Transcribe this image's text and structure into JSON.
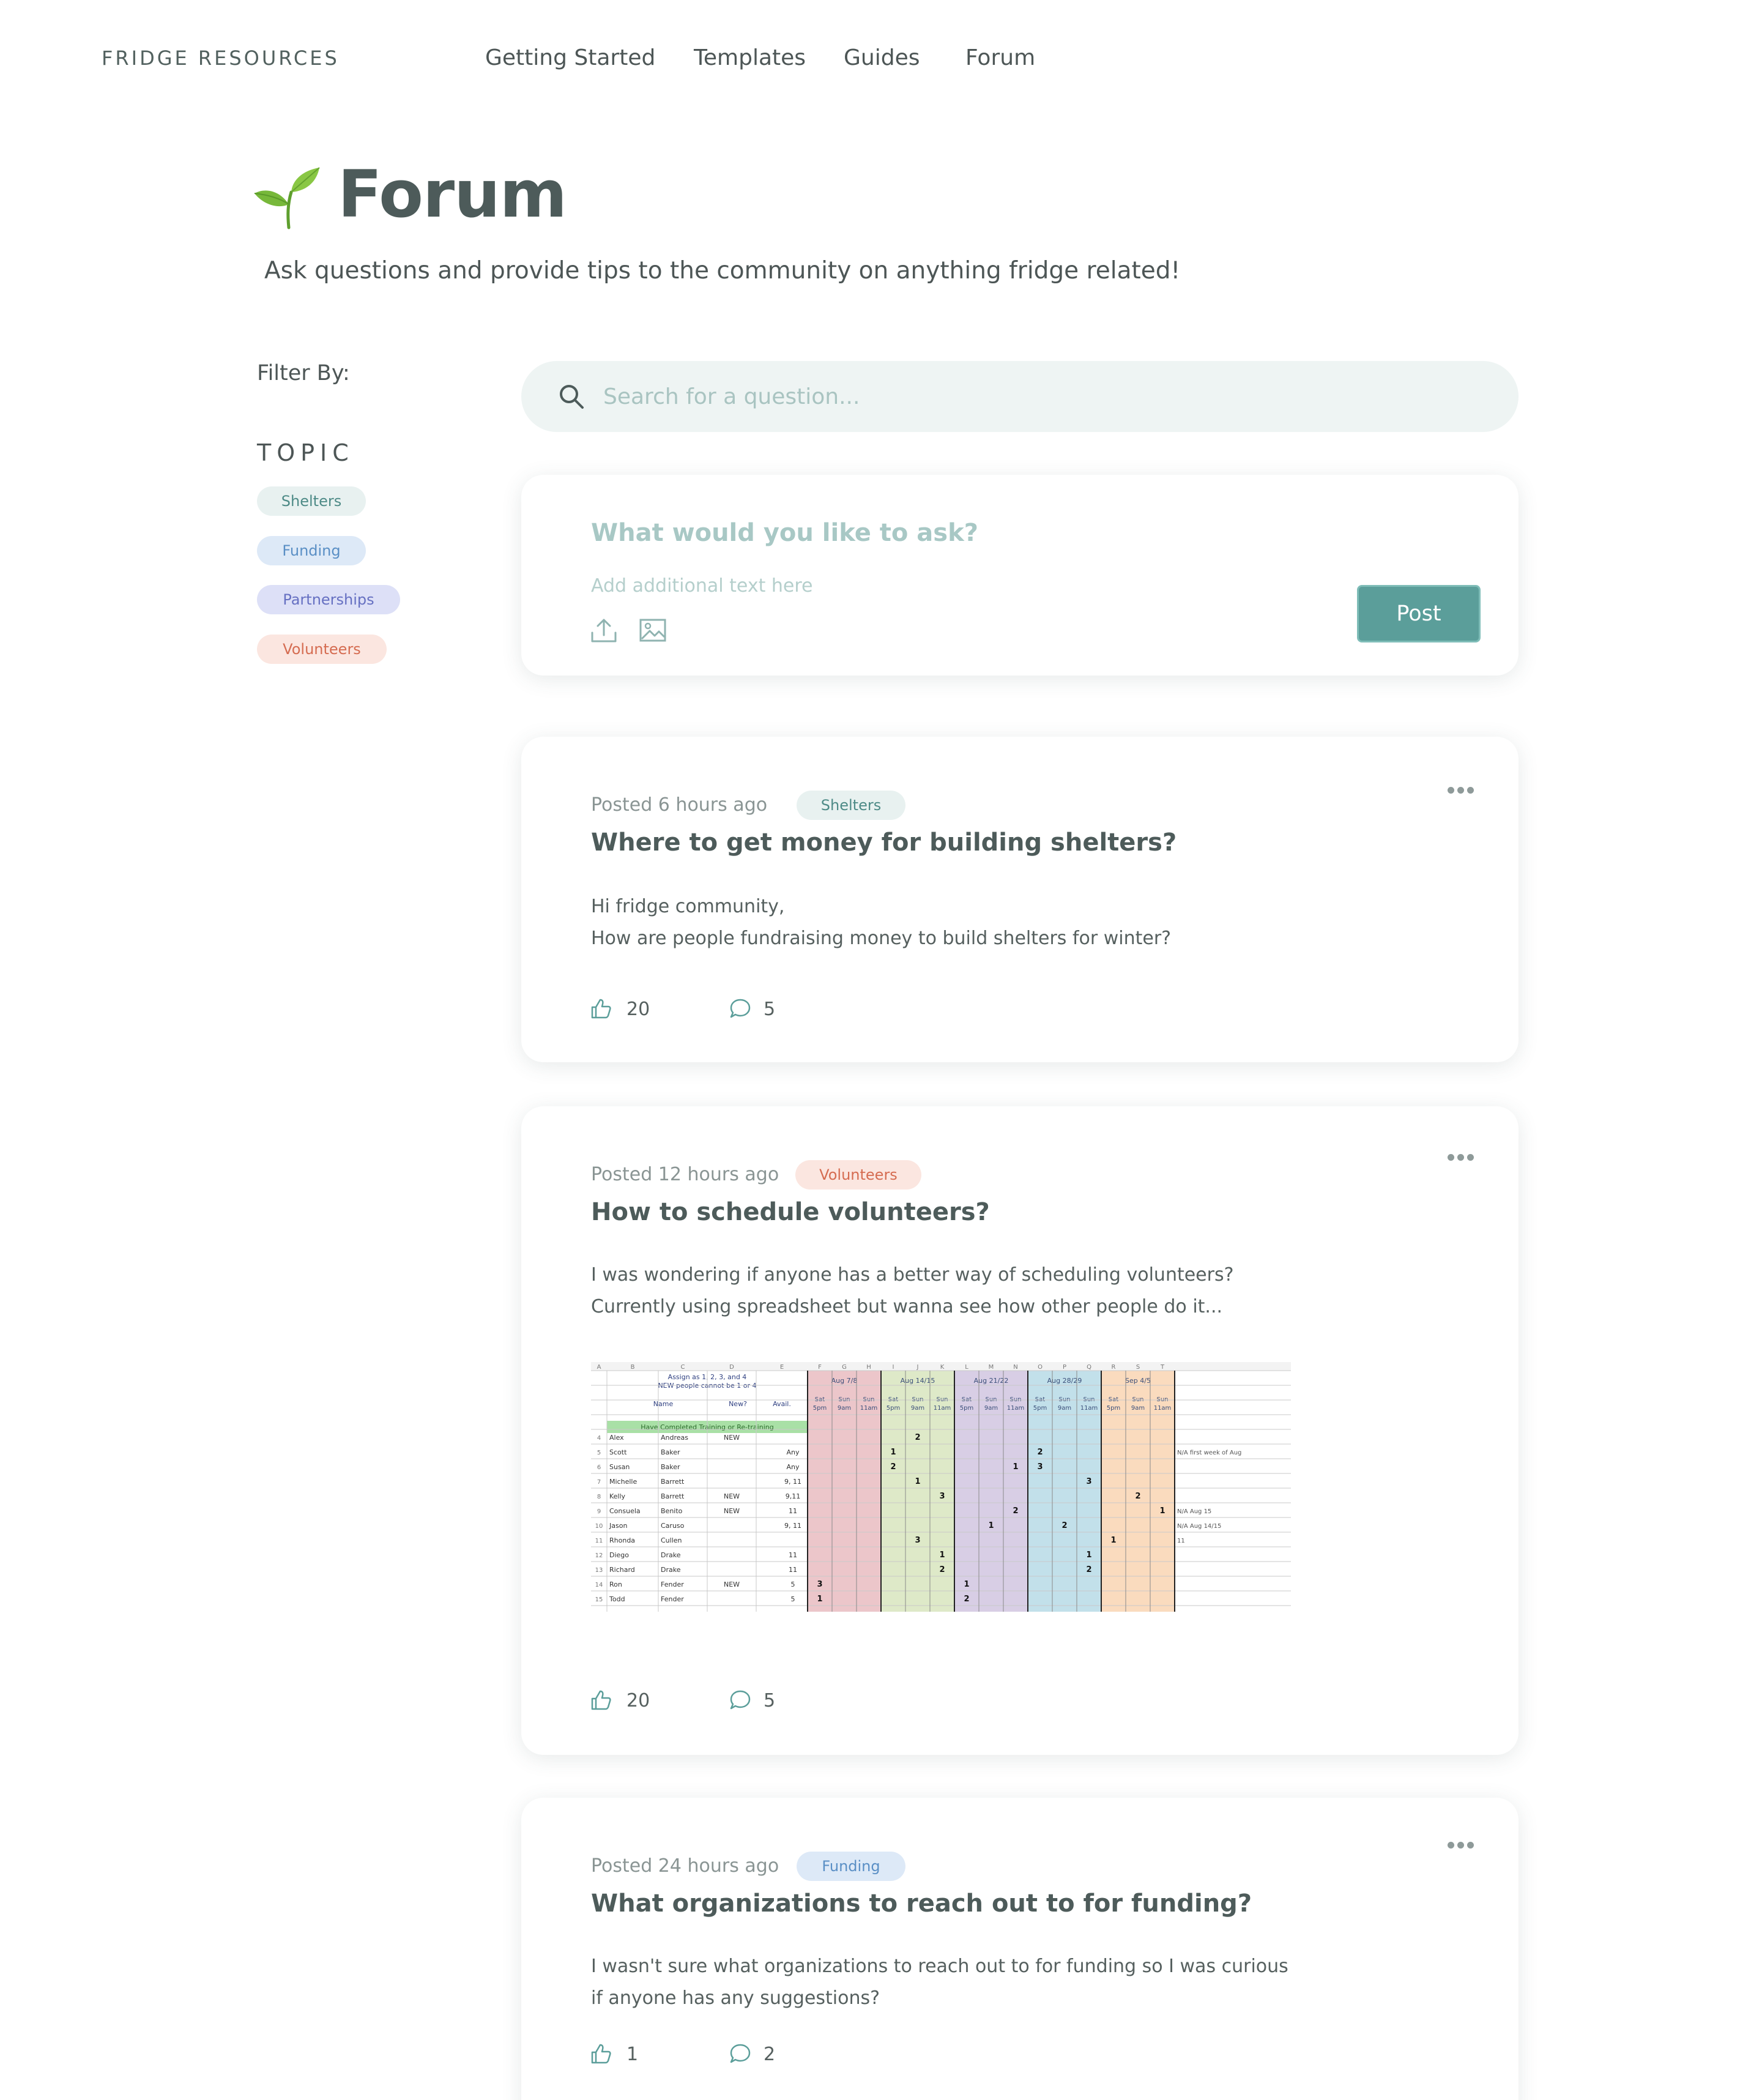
{
  "header": {
    "brand": "FRIDGE RESOURCES",
    "nav": [
      "Getting Started",
      "Templates",
      "Guides",
      "Forum"
    ]
  },
  "hero": {
    "icon": "seedling-icon",
    "title": "Forum",
    "subtitle": "Ask questions and provide tips to the community on anything fridge related!"
  },
  "sidebar": {
    "filter_label": "Filter By:",
    "topic_label": "TOPIC",
    "topics": [
      "Shelters",
      "Funding",
      "Partnerships",
      "Volunteers"
    ]
  },
  "search": {
    "placeholder": "Search for a question..."
  },
  "ask": {
    "placeholder_title": "What would you like to ask?",
    "placeholder_body": "Add additional text here",
    "post_label": "Post",
    "icons": [
      "upload-icon",
      "image-icon"
    ]
  },
  "posts": [
    {
      "posted": "Posted 6 hours ago",
      "tag": "Shelters",
      "title": "Where to get money for building shelters?",
      "body": [
        "Hi fridge community,",
        "How are people fundraising money to build shelters for winter?"
      ],
      "likes": "20",
      "comments": "5"
    },
    {
      "posted": "Posted 12 hours ago",
      "tag": "Volunteers",
      "title": "How to schedule volunteers?",
      "body": [
        "I was wondering if anyone has a better way of scheduling volunteers?",
        "Currently using spreadsheet but wanna see how other people do it..."
      ],
      "likes": "20",
      "comments": "5",
      "spreadsheet": {
        "column_letters": [
          "A",
          "B",
          "C",
          "D",
          "E",
          "F",
          "G",
          "H",
          "I",
          "J",
          "K",
          "L",
          "M",
          "N",
          "O",
          "P",
          "Q",
          "R",
          "S",
          "T"
        ],
        "note_line1": "Assign as 1, 2, 3, and 4",
        "note_line2": "NEW people cannot be 1 or 4",
        "headers": [
          "Name",
          "New?",
          "Avail."
        ],
        "training_note": "Have Completed Training or Re-training",
        "weeks": [
          "Aug 7/8",
          "Aug 14/15",
          "Aug 21/22",
          "Aug 28/29",
          "Sep 4/5"
        ],
        "slot_days": [
          "Sat",
          "Sun",
          "Sun"
        ],
        "slot_times": [
          "5pm",
          "9am",
          "11am"
        ],
        "rows": [
          {
            "first": "Alex",
            "last": "Andreas",
            "new": "NEW",
            "avail": "",
            "marks": [
              [
                4,
                "2"
              ]
            ],
            "note": ""
          },
          {
            "first": "Scott",
            "last": "Baker",
            "new": "",
            "avail": "Any",
            "marks": [
              [
                3,
                "1"
              ],
              [
                9,
                "2"
              ]
            ],
            "note": "N/A first week of Aug"
          },
          {
            "first": "Susan",
            "last": "Baker",
            "new": "",
            "avail": "Any",
            "marks": [
              [
                3,
                "2"
              ],
              [
                8,
                "1"
              ],
              [
                9,
                "3"
              ]
            ],
            "note": ""
          },
          {
            "first": "Michelle",
            "last": "Barrett",
            "new": "",
            "avail": "9, 11",
            "marks": [
              [
                4,
                "1"
              ],
              [
                11,
                "3"
              ]
            ],
            "note": ""
          },
          {
            "first": "Kelly",
            "last": "Barrett",
            "new": "NEW",
            "avail": "9,11",
            "marks": [
              [
                5,
                "3"
              ],
              [
                13,
                "2"
              ]
            ],
            "note": ""
          },
          {
            "first": "Consuela",
            "last": "Benito",
            "new": "NEW",
            "avail": "11",
            "marks": [
              [
                8,
                "2"
              ],
              [
                14,
                "1"
              ]
            ],
            "note": "N/A Aug 15"
          },
          {
            "first": "Jason",
            "last": "Caruso",
            "new": "",
            "avail": "9, 11",
            "marks": [
              [
                7,
                "1"
              ],
              [
                10,
                "2"
              ]
            ],
            "note": "N/A Aug 14/15"
          },
          {
            "first": "Rhonda",
            "last": "Cullen",
            "new": "",
            "avail": "",
            "marks": [
              [
                4,
                "3"
              ],
              [
                12,
                "1"
              ]
            ],
            "note": "11"
          },
          {
            "first": "Diego",
            "last": "Drake",
            "new": "",
            "avail": "11",
            "marks": [
              [
                5,
                "1"
              ],
              [
                11,
                "1"
              ]
            ],
            "note": ""
          },
          {
            "first": "Richard",
            "last": "Drake",
            "new": "",
            "avail": "11",
            "marks": [
              [
                5,
                "2"
              ],
              [
                11,
                "2"
              ]
            ],
            "note": ""
          },
          {
            "first": "Ron",
            "last": "Fender",
            "new": "NEW",
            "avail": "5",
            "marks": [
              [
                0,
                "3"
              ],
              [
                6,
                "1"
              ]
            ],
            "note": ""
          },
          {
            "first": "Todd",
            "last": "Fender",
            "new": "",
            "avail": "5",
            "marks": [
              [
                0,
                "1"
              ],
              [
                6,
                "2"
              ]
            ],
            "note": ""
          }
        ],
        "week_colors": [
          "#e6b3b8",
          "#d3e2b5",
          "#cbbedc",
          "#aed6e3",
          "#f8cfa8"
        ]
      }
    },
    {
      "posted": "Posted 24 hours ago",
      "tag": "Funding",
      "title": "What organizations to reach out to for funding?",
      "body": [
        "I wasn't sure what organizations to reach out to for funding so I was curious",
        "if anyone has any suggestions?"
      ],
      "likes": "1",
      "comments": "2"
    }
  ],
  "colors": {
    "accent": "#5b9e9a",
    "shelters": "#4e8b87",
    "funding": "#5a8fc5",
    "partnerships": "#6670c2",
    "volunteers": "#d56c51"
  }
}
